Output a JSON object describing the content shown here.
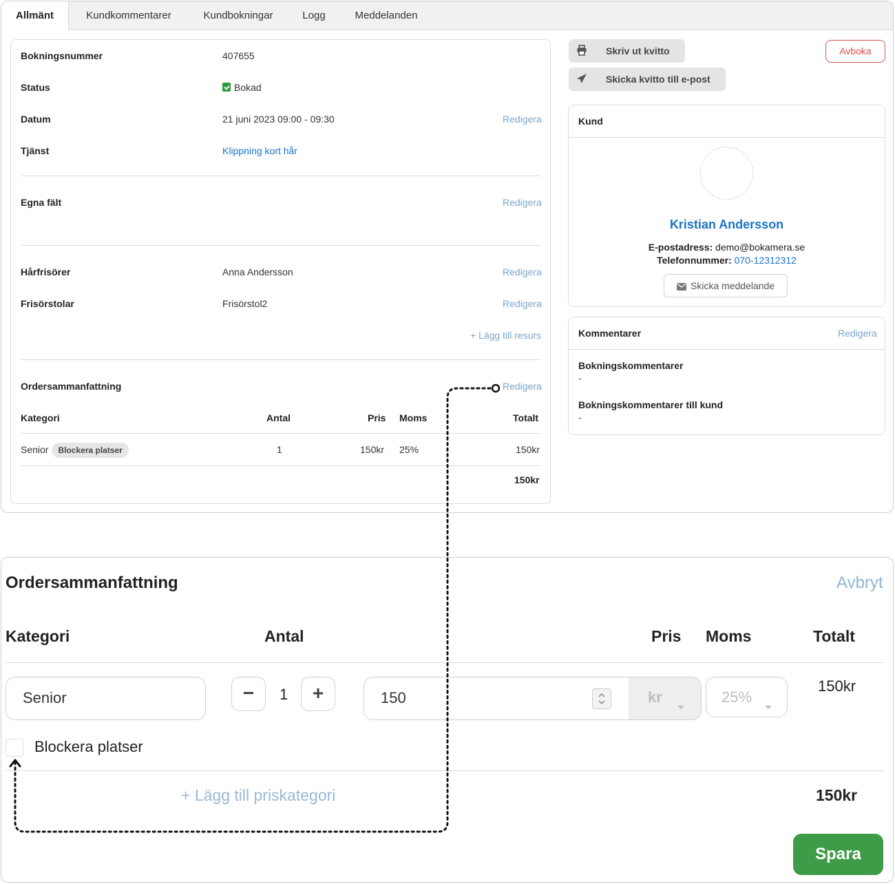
{
  "tabs": [
    {
      "label": "Allmänt",
      "active": true
    },
    {
      "label": "Kundkommentarer"
    },
    {
      "label": "Kundbokningar"
    },
    {
      "label": "Logg"
    },
    {
      "label": "Meddelanden"
    }
  ],
  "booking": {
    "number_label": "Bokningsnummer",
    "number": "407655",
    "status_label": "Status",
    "status": "Bokad",
    "date_label": "Datum",
    "date": "21 juni 2023 09:00 - 09:30",
    "service_label": "Tjänst",
    "service": "Klippning kort hår",
    "custom_fields_label": "Egna fält",
    "stylists_label": "Hårfrisörer",
    "stylist": "Anna Andersson",
    "chairs_label": "Frisörstolar",
    "chair": "Frisörstol2",
    "add_resource": "+ Lägg till resurs",
    "edit_label": "Redigera"
  },
  "order_summary": {
    "title": "Ordersammanfattning",
    "edit_label": "Redigera",
    "columns": {
      "category": "Kategori",
      "quantity": "Antal",
      "price": "Pris",
      "vat": "Moms",
      "total": "Totalt"
    },
    "rows": [
      {
        "category": "Senior",
        "badge": "Blockera platser",
        "quantity": "1",
        "price": "150kr",
        "vat": "25%",
        "total": "150kr"
      }
    ],
    "grand_total": "150kr"
  },
  "actions": {
    "print_receipt": "Skriv ut kvitto",
    "email_receipt": "Skicka kvitto till e-post",
    "cancel": "Avboka"
  },
  "customer": {
    "title": "Kund",
    "name": "Kristian Andersson",
    "email_label": "E-postadress:",
    "email": "demo@bokamera.se",
    "phone_label": "Telefonnummer:",
    "phone": "070-12312312",
    "send_message": "Skicka meddelande"
  },
  "comments": {
    "title": "Kommentarer",
    "edit_label": "Redigera",
    "booking_comments_label": "Bokningskommentarer",
    "booking_comments": "-",
    "customer_comments_label": "Bokningskommentarer till kund",
    "customer_comments": "-"
  },
  "edit_panel": {
    "title": "Ordersammanfattning",
    "cancel": "Avbryt",
    "columns": {
      "category": "Kategori",
      "quantity": "Antal",
      "price": "Pris",
      "vat": "Moms",
      "total": "Totalt"
    },
    "category_value": "Senior",
    "minus": "−",
    "quantity": "1",
    "plus": "+",
    "price_value": "150",
    "currency": "kr",
    "vat_value": "25%",
    "row_total": "150kr",
    "block_seats_label": "Blockera platser",
    "block_seats_checked": false,
    "add_price_category": "+ Lägg till priskategori",
    "grand_total": "150kr",
    "save": "Spara"
  },
  "colors": {
    "link": "#1a73c8",
    "save_green": "#3e9b48",
    "cancel_red": "#d9534f",
    "status_green": "#2e9b3a"
  }
}
